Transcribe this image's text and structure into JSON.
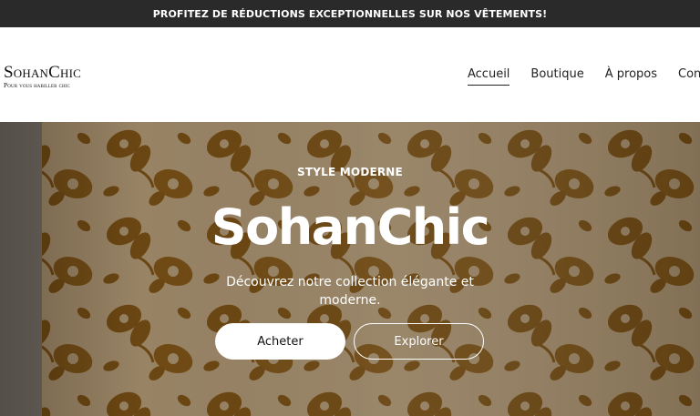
{
  "announcement": {
    "text": "PROFITEZ DE RÉDUCTIONS EXCEPTIONNELLES SUR NOS VÊTEMENTS!"
  },
  "brand": {
    "name": "SohanChic",
    "tagline": "Pour vous habiller chic"
  },
  "nav": {
    "items": [
      {
        "label": "Accueil",
        "active": true
      },
      {
        "label": "Boutique"
      },
      {
        "label": "À propos"
      },
      {
        "label": "Contact"
      }
    ]
  },
  "hero": {
    "eyebrow": "STYLE MODERNE",
    "title": "SohanChic",
    "subtitle": "Découvrez notre collection élégante et moderne.",
    "primary_button": "Acheter",
    "secondary_button": "Explorer",
    "image_name": "floral-fabric-background"
  },
  "colors": {
    "announcement_bg": "#2a2a2a",
    "fabric_base": "#c9b08a",
    "fabric_pattern": "#8a5c18"
  }
}
